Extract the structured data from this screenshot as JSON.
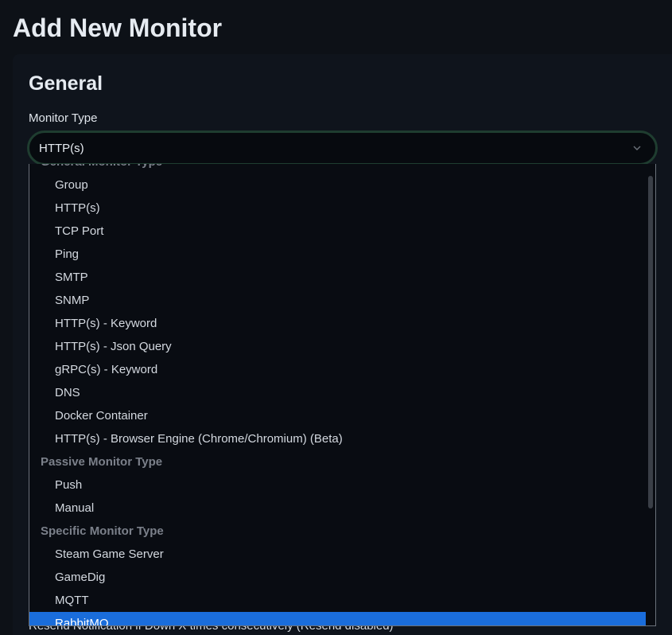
{
  "page": {
    "title": "Add New Monitor"
  },
  "section": {
    "title": "General"
  },
  "monitor_type": {
    "label": "Monitor Type",
    "value": "HTTP(s)",
    "groups": [
      {
        "label": "General Monitor Type",
        "options": [
          "Group",
          "HTTP(s)",
          "TCP Port",
          "Ping",
          "SMTP",
          "SNMP",
          "HTTP(s) - Keyword",
          "HTTP(s) - Json Query",
          "gRPC(s) - Keyword",
          "DNS",
          "Docker Container",
          "HTTP(s) - Browser Engine (Chrome/Chromium) (Beta)"
        ]
      },
      {
        "label": "Passive Monitor Type",
        "options": [
          "Push",
          "Manual"
        ]
      },
      {
        "label": "Specific Monitor Type",
        "options": [
          "Steam Game Server",
          "GameDig",
          "MQTT",
          "RabbitMQ"
        ]
      }
    ],
    "highlighted_option": "RabbitMQ"
  },
  "below_field": {
    "text": "Resend Notification if Down X times consecutively (Resend disabled)"
  },
  "colors": {
    "highlight": "#1a6ddb",
    "focus_border": "#1f3d30"
  },
  "icons": {
    "select_arrow": "chevron-down-icon"
  }
}
